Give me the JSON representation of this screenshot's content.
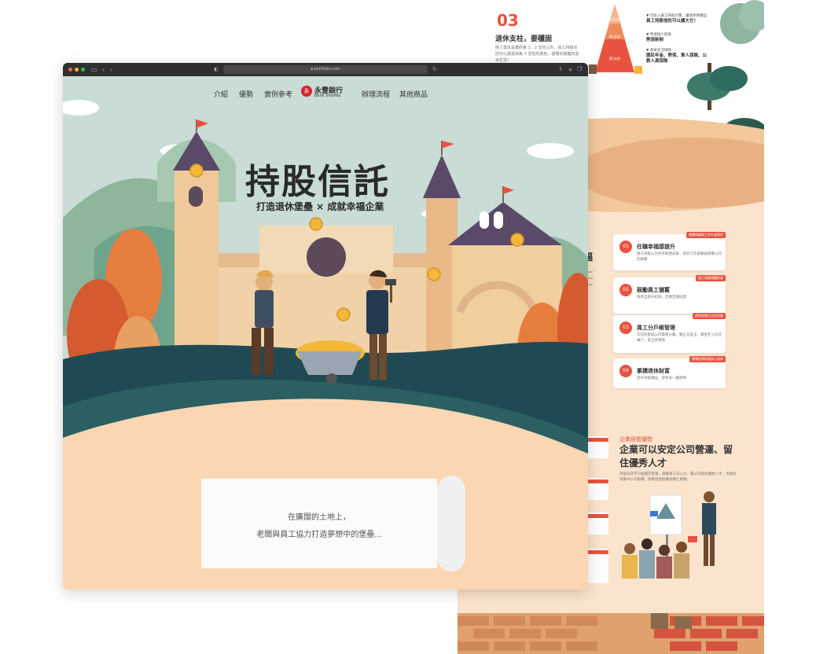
{
  "browser": {
    "url": "portfolio.com"
  },
  "nav": {
    "items": [
      "介紹",
      "優勢",
      "實例參考",
      "辦理流程",
      "其他商品"
    ],
    "logo_cn": "永豐銀行",
    "logo_en": "Bank SinoPac"
  },
  "hero": {
    "title": "持股信託",
    "subtitle": "打造退休堡壘 × 成就幸福企業"
  },
  "scroll": {
    "line1": "在廣闊的土地上，",
    "line2": "老闆與員工協力打造夢想中的堡壘..."
  },
  "back_page": {
    "pillar_number": "03",
    "pillar_title": "退休支柱，要穩固",
    "pillar_desc": "除了基本具優的第 1、2 支柱以外，員工持股信託可以讓退休第 3 支柱的角色，建構出穩健的退休生活！",
    "pyramid": {
      "levels": [
        "第3支柱",
        "第2支柱",
        "第1支柱"
      ],
      "notes": [
        {
          "head": "▼ 可投入員工持股計畫，讓退休更穩固",
          "body": "員工持股信託可以擴大它！"
        },
        {
          "head": "▼ 勞退個人提撥",
          "body": "勞退新制"
        },
        {
          "head": "▼ 基本生活保障",
          "body": "國民年金、勞保、軍人保險、公教人員保險"
        }
      ]
    },
    "side_title": "福",
    "cards": [
      {
        "num": "01",
        "tag": "善盡照顧員工的社會責任",
        "title": "任職幸福感提升",
        "desc": "員工持股公司共享經營成果，提昇工作意願與榮譽公司的歸屬"
      },
      {
        "num": "02",
        "tag": "員工長期規劃投資",
        "title": "鼓勵員工儲蓄",
        "desc": "每月自薪水扣除，定期定額投資"
      },
      {
        "num": "03",
        "tag": "透明化獨立信託財產",
        "title": "員工分戶帳管理",
        "desc": "信託財產與公司資產分離，獨立又安全，資金存入信託專戶，安全有保障"
      },
      {
        "num": "04",
        "tag": "累積退休財富安心退休",
        "title": "累積退休財富",
        "desc": "提升持股權益，退休多一層保障"
      }
    ],
    "section_label": "企業經營優勢",
    "section_title": "企業可以安定公司營運、留住優秀人才",
    "section_desc": "持股信託不只能穩定營運，凝聚員工向心力，幫公司留住優秀人才；也能有效集中公司股權，防範惡意股權收購之風險。"
  },
  "colors": {
    "accent": "#e8533f",
    "sky": "#c9dcd6",
    "ground": "#fbd6b3",
    "forest": "#1f4a54"
  }
}
